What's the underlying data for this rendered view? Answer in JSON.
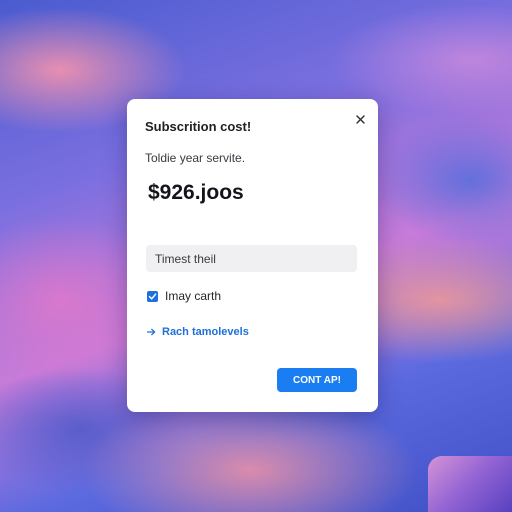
{
  "dialog": {
    "title": "Subscrition cost!",
    "subtitle": "Toldie year servite.",
    "price": "$926.joos",
    "field_placeholder": "Timest theil",
    "checkbox_label": "Imay carth",
    "checkbox_checked": true,
    "link_label": "Rach tamolevels",
    "button_label": "CONT AP!"
  },
  "colors": {
    "accent": "#1a7ef2",
    "link": "#1f6fd8",
    "dialog_bg": "#ffffff"
  },
  "icons": {
    "close": "close-icon",
    "check": "checkmark-icon",
    "link": "arrow-right-icon"
  }
}
